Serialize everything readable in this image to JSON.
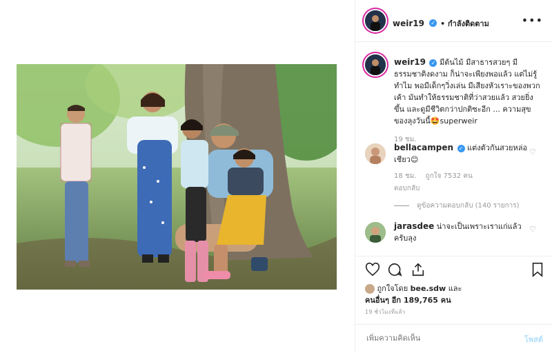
{
  "author": {
    "username": "weir19",
    "follow_label": "• กำลังติดตาม"
  },
  "caption": {
    "username": "weir19",
    "text": "มีต้นไม้ มีสาธารสวยๆ มีธรรมชาติงดงาม ก็น่าจะเพียงพอแล้ว แต่ไม่รู้ทำไม พอมีเด็กๆวิ่งเล่น มีเสียงหัวเราะของพวกเค้า มันทำให้ธรรมชาติที่ว่าสวยแล้ว สวยยิ่งขึ้น และดูมีชีวิตกว่าปกติซะอีก ... ความสุขของลุงวันนี้",
    "emoji": "🤩",
    "mention": "superweir",
    "time": "19 ชม."
  },
  "comments": [
    {
      "username": "bellacampen",
      "verified": true,
      "text": "แต่งตัวกันสวยหล่อเชียว",
      "emoji": "😊",
      "time": "18 ชม.",
      "likes": "ถูกใจ 7532 คน",
      "reply": "ตอบกลับ",
      "view_replies": "ดูข้อความตอบกลับ (140 รายการ)"
    },
    {
      "username": "jarasdee",
      "verified": false,
      "text": "น่าจะเป็นเพราะเราแก่แล้วครับลุง"
    }
  ],
  "likes": {
    "prefix": "ถูกใจโดย",
    "user": "bee.sdw",
    "and": "และ",
    "others": "คนอื่นๆ อีก 189,765 คน"
  },
  "timestamp": "19 ชั่วโมงที่แล้ว",
  "add_comment": {
    "placeholder": "เพิ่มความคิดเห็น",
    "post_label": "โพสต์"
  },
  "icons": {
    "like": "heart-icon",
    "comment": "comment-icon",
    "share": "share-icon",
    "save": "bookmark-icon",
    "more": "more-icon"
  },
  "colors": {
    "verified": "#3897f0",
    "post_button": "#b2dffc",
    "text": "#262626",
    "muted": "#999999"
  }
}
